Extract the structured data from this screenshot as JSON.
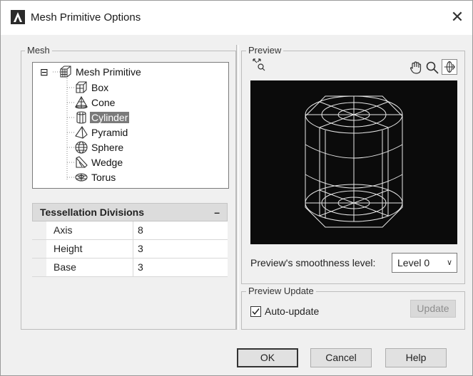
{
  "window": {
    "title": "Mesh Primitive Options",
    "close_glyph": "✕"
  },
  "mesh_group": {
    "label": "Mesh",
    "tree": {
      "root": {
        "label": "Mesh Primitive",
        "expander": "⊟",
        "icon": "mesh-primitive-icon"
      },
      "items": [
        {
          "label": "Box",
          "icon": "box-icon"
        },
        {
          "label": "Cone",
          "icon": "cone-icon"
        },
        {
          "label": "Cylinder",
          "icon": "cylinder-icon",
          "selected": true
        },
        {
          "label": "Pyramid",
          "icon": "pyramid-icon"
        },
        {
          "label": "Sphere",
          "icon": "sphere-icon"
        },
        {
          "label": "Wedge",
          "icon": "wedge-icon"
        },
        {
          "label": "Torus",
          "icon": "torus-icon"
        }
      ]
    },
    "tessellation": {
      "header": "Tessellation Divisions",
      "collapse_glyph": "–",
      "rows": [
        {
          "name": "Axis",
          "value": "8"
        },
        {
          "name": "Height",
          "value": "3"
        },
        {
          "name": "Base",
          "value": "3"
        }
      ]
    }
  },
  "preview_group": {
    "label": "Preview",
    "tools": [
      "zoom-extents-icon",
      "pan-hand-icon",
      "zoom-icon",
      "orbit-icon"
    ],
    "canvas_bg": "#0b0b0b",
    "wire_color": "#e8e8e8",
    "smoothness_label": "Preview's smoothness level:",
    "smoothness_value": "Level 0"
  },
  "preview_update_group": {
    "label": "Preview Update",
    "auto_update_label": "Auto-update",
    "auto_update_checked": true,
    "update_button": "Update"
  },
  "buttons": {
    "ok": "OK",
    "cancel": "Cancel",
    "help": "Help"
  }
}
